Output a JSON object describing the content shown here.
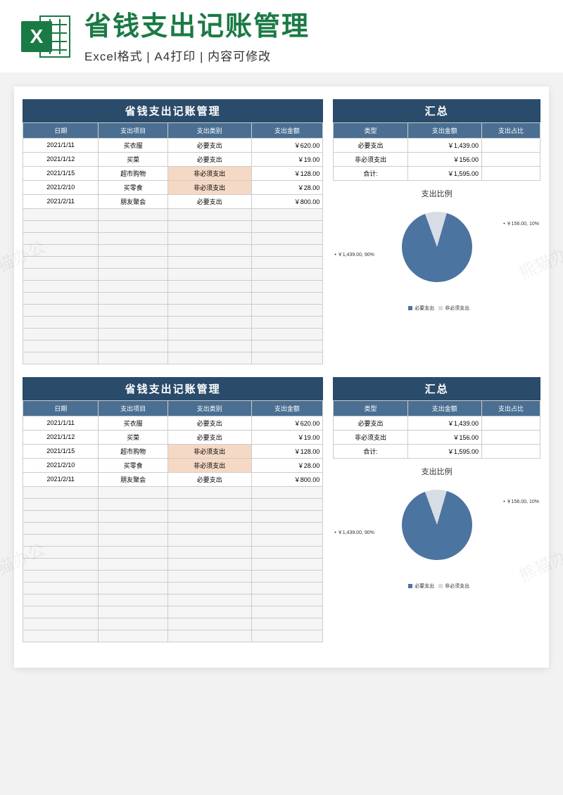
{
  "header": {
    "icon_letter": "X",
    "title": "省钱支出记账管理",
    "subtitle": "Excel格式 | A4打印 | 内容可修改"
  },
  "colors": {
    "dark_blue": "#2a4b6a",
    "mid_blue": "#4a6f92",
    "pie_main": "#4c74a0",
    "pie_slice": "#d7dde5",
    "highlight": "#f5d9c5"
  },
  "expense_table": {
    "title": "省钱支出记账管理",
    "headers": [
      "日期",
      "支出项目",
      "支出类别",
      "支出金额"
    ],
    "rows": [
      {
        "date": "2021/1/11",
        "item": "买衣服",
        "category": "必要支出",
        "amount": "￥620.00",
        "hl": false
      },
      {
        "date": "2021/1/12",
        "item": "买菜",
        "category": "必要支出",
        "amount": "￥19.00",
        "hl": false
      },
      {
        "date": "2021/1/15",
        "item": "超市购物",
        "category": "非必须支出",
        "amount": "￥128.00",
        "hl": true
      },
      {
        "date": "2021/2/10",
        "item": "买零食",
        "category": "非必须支出",
        "amount": "￥28.00",
        "hl": true
      },
      {
        "date": "2021/2/11",
        "item": "朋友聚会",
        "category": "必要支出",
        "amount": "￥800.00",
        "hl": false
      }
    ],
    "empty_rows": 13
  },
  "summary_table": {
    "title": "汇总",
    "headers": [
      "类型",
      "支出金额",
      "支出占比"
    ],
    "rows": [
      {
        "type": "必要支出",
        "amount": "￥1,439.00",
        "ratio": ""
      },
      {
        "type": "非必须支出",
        "amount": "￥156.00",
        "ratio": ""
      },
      {
        "type": "合计:",
        "amount": "￥1,595.00",
        "ratio": ""
      }
    ]
  },
  "chart_data": {
    "type": "pie",
    "title": "支出比例",
    "series": [
      {
        "name": "必要支出",
        "value": 1439.0,
        "percent": 90,
        "label": "￥1,439.00, 90%",
        "color": "#4c74a0"
      },
      {
        "name": "非必须支出",
        "value": 156.0,
        "percent": 10,
        "label": "￥156.00, 10%",
        "color": "#d7dde5"
      }
    ],
    "legend": [
      "必要支出",
      "非必须支出"
    ]
  },
  "watermark": "熊猫办公"
}
